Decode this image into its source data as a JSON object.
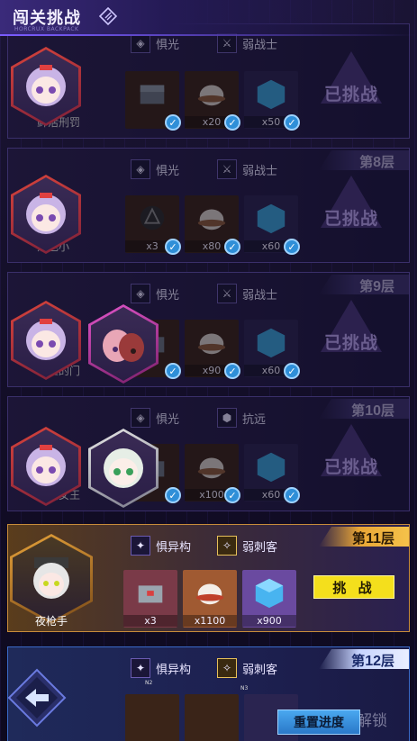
{
  "header": {
    "title": "闯关挑战",
    "subtitle": "HORCRUX BACKPACK"
  },
  "stages": [
    {
      "floor_prefix": "",
      "floor_num": "",
      "floor_suffix": "",
      "attr1": "惧光",
      "attr2": "弱战士",
      "enemy_name": "鲜活刑罚",
      "rewards": [
        "",
        "x20",
        "x50"
      ],
      "status": "已挑战"
    },
    {
      "floor_prefix": "第",
      "floor_num": "8",
      "floor_suffix": "层",
      "attr1": "惧光",
      "attr2": "弱战士",
      "enemy_name": "黑色小",
      "rewards": [
        "x3",
        "x80",
        "x60"
      ],
      "status": "已挑战"
    },
    {
      "floor_prefix": "第",
      "floor_num": "9",
      "floor_suffix": "层",
      "attr1": "惧光",
      "attr2": "弱战士",
      "enemy_name": "冒险的门",
      "rewards": [
        "",
        "x90",
        "x60"
      ],
      "status": "已挑战"
    },
    {
      "floor_prefix": "第",
      "floor_num": "10",
      "floor_suffix": "层",
      "attr1": "惧光",
      "attr2": "抗远",
      "enemy_name": "黯翼女王",
      "rewards": [
        "",
        "x100",
        "x60"
      ],
      "status": "已挑战"
    },
    {
      "floor_prefix": "第",
      "floor_num": "11",
      "floor_suffix": "层",
      "attr1": "惧异构",
      "attr2": "弱刺客",
      "enemy_name": "夜枪手",
      "rewards": [
        "x3",
        "x1100",
        "x900"
      ],
      "button": "挑 战"
    },
    {
      "floor_prefix": "第",
      "floor_num": "12",
      "floor_suffix": "层",
      "attr1": "惧异构",
      "attr2": "弱刺客",
      "attr1_badge": "N2",
      "attr2_badge": "N3"
    }
  ],
  "footer": {
    "reset_label": "重置进度",
    "unlock_label": "解锁"
  }
}
